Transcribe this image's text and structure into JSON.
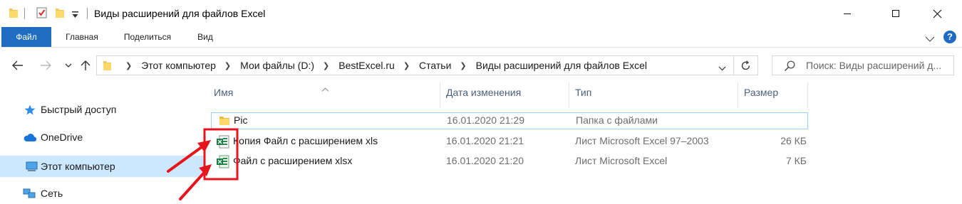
{
  "window": {
    "title": "Виды расширений для файлов Excel",
    "minimize_icon": "minimize-icon",
    "maximize_icon": "maximize-icon",
    "close_icon": "close-icon"
  },
  "ribbon": {
    "tabs": [
      "Файл",
      "Главная",
      "Поделиться",
      "Вид"
    ],
    "help_label": "?",
    "accent": "#1e6dc2"
  },
  "address": {
    "crumbs": [
      "Этот компьютер",
      "Мои файлы (D:)",
      "BestExcel.ru",
      "Статьи",
      "Виды расширений для файлов Excel"
    ],
    "search_placeholder": "Поиск: Виды расширений д..."
  },
  "sidebar": {
    "items": [
      {
        "label": "Быстрый доступ",
        "icon": "star-icon"
      },
      {
        "label": "OneDrive",
        "icon": "cloud-icon"
      },
      {
        "label": "Этот компьютер",
        "icon": "computer-icon",
        "selected": true
      },
      {
        "label": "Сеть",
        "icon": "network-icon"
      }
    ]
  },
  "columns": {
    "name": "Имя",
    "date": "Дата изменения",
    "type": "Тип",
    "size": "Размер"
  },
  "files": [
    {
      "name": "Pic",
      "date": "16.01.2020 21:29",
      "type": "Папка с файлами",
      "size": "",
      "icon": "folder-icon"
    },
    {
      "name": "Копия Файл с расширением xls",
      "date": "16.01.2020 21:21",
      "type": "Лист Microsoft Excel 97–2003",
      "size": "26 КБ",
      "icon": "excel-xls-icon"
    },
    {
      "name": "Файл с расширением xlsx",
      "date": "16.01.2020 21:20",
      "type": "Лист Microsoft Excel",
      "size": "7 КБ",
      "icon": "excel-xlsx-icon"
    }
  ],
  "annotation_color": "#e8141c"
}
